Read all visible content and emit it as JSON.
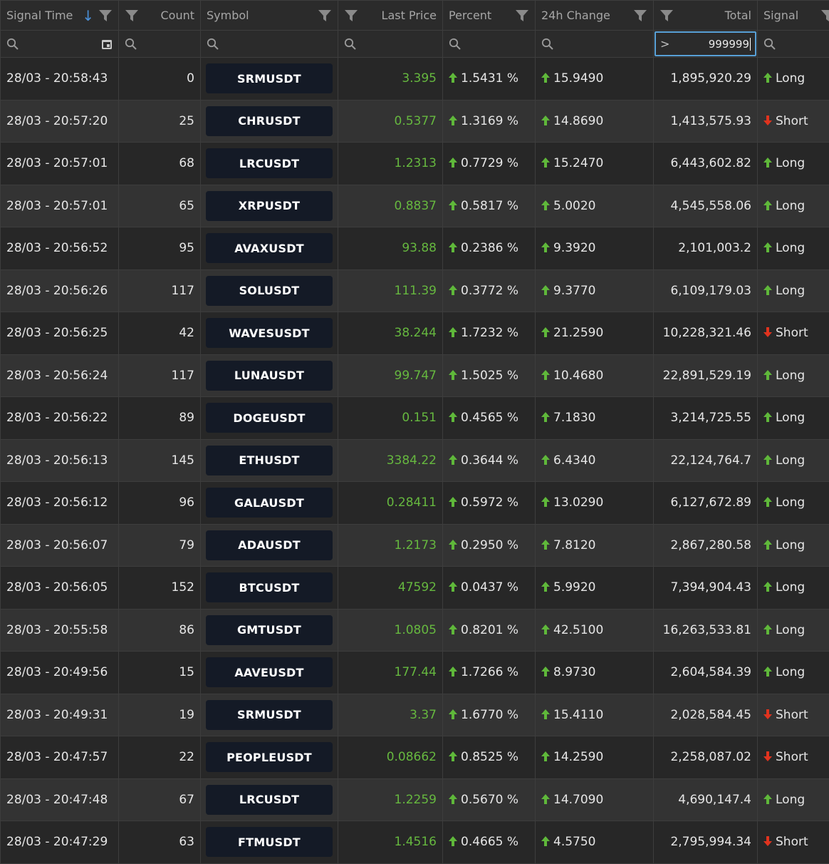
{
  "columns": {
    "signal_time": "Signal Time",
    "count": "Count",
    "symbol": "Symbol",
    "last_price": "Last Price",
    "percent": "Percent",
    "change_24h": "24h Change",
    "total": "Total",
    "signal": "Signal"
  },
  "filter": {
    "total_operator": ">",
    "total_value": "999999"
  },
  "colors": {
    "price_green": "#66b83f",
    "up_arrow": "#5fb83a",
    "down_arrow": "#e0331e",
    "focus_border": "#58a0d6",
    "symbol_bg": "#141a26"
  },
  "rows": [
    {
      "time": "28/03 - 20:58:43",
      "count": "0",
      "symbol": "SRMUSDT",
      "price": "3.395",
      "percent": "1.5431 %",
      "change": "15.9490",
      "total": "1,895,920.29",
      "signal": "Long"
    },
    {
      "time": "28/03 - 20:57:20",
      "count": "25",
      "symbol": "CHRUSDT",
      "price": "0.5377",
      "percent": "1.3169 %",
      "change": "14.8690",
      "total": "1,413,575.93",
      "signal": "Short"
    },
    {
      "time": "28/03 - 20:57:01",
      "count": "68",
      "symbol": "LRCUSDT",
      "price": "1.2313",
      "percent": "0.7729 %",
      "change": "15.2470",
      "total": "6,443,602.82",
      "signal": "Long"
    },
    {
      "time": "28/03 - 20:57:01",
      "count": "65",
      "symbol": "XRPUSDT",
      "price": "0.8837",
      "percent": "0.5817 %",
      "change": "5.0020",
      "total": "4,545,558.06",
      "signal": "Long"
    },
    {
      "time": "28/03 - 20:56:52",
      "count": "95",
      "symbol": "AVAXUSDT",
      "price": "93.88",
      "percent": "0.2386 %",
      "change": "9.3920",
      "total": "2,101,003.2",
      "signal": "Long"
    },
    {
      "time": "28/03 - 20:56:26",
      "count": "117",
      "symbol": "SOLUSDT",
      "price": "111.39",
      "percent": "0.3772 %",
      "change": "9.3770",
      "total": "6,109,179.03",
      "signal": "Long"
    },
    {
      "time": "28/03 - 20:56:25",
      "count": "42",
      "symbol": "WAVESUSDT",
      "price": "38.244",
      "percent": "1.7232 %",
      "change": "21.2590",
      "total": "10,228,321.46",
      "signal": "Short"
    },
    {
      "time": "28/03 - 20:56:24",
      "count": "117",
      "symbol": "LUNAUSDT",
      "price": "99.747",
      "percent": "1.5025 %",
      "change": "10.4680",
      "total": "22,891,529.19",
      "signal": "Long"
    },
    {
      "time": "28/03 - 20:56:22",
      "count": "89",
      "symbol": "DOGEUSDT",
      "price": "0.151",
      "percent": "0.4565 %",
      "change": "7.1830",
      "total": "3,214,725.55",
      "signal": "Long"
    },
    {
      "time": "28/03 - 20:56:13",
      "count": "145",
      "symbol": "ETHUSDT",
      "price": "3384.22",
      "percent": "0.3644 %",
      "change": "6.4340",
      "total": "22,124,764.7",
      "signal": "Long"
    },
    {
      "time": "28/03 - 20:56:12",
      "count": "96",
      "symbol": "GALAUSDT",
      "price": "0.28411",
      "percent": "0.5972 %",
      "change": "13.0290",
      "total": "6,127,672.89",
      "signal": "Long"
    },
    {
      "time": "28/03 - 20:56:07",
      "count": "79",
      "symbol": "ADAUSDT",
      "price": "1.2173",
      "percent": "0.2950 %",
      "change": "7.8120",
      "total": "2,867,280.58",
      "signal": "Long"
    },
    {
      "time": "28/03 - 20:56:05",
      "count": "152",
      "symbol": "BTCUSDT",
      "price": "47592",
      "percent": "0.0437 %",
      "change": "5.9920",
      "total": "7,394,904.43",
      "signal": "Long"
    },
    {
      "time": "28/03 - 20:55:58",
      "count": "86",
      "symbol": "GMTUSDT",
      "price": "1.0805",
      "percent": "0.8201 %",
      "change": "42.5100",
      "total": "16,263,533.81",
      "signal": "Long"
    },
    {
      "time": "28/03 - 20:49:56",
      "count": "15",
      "symbol": "AAVEUSDT",
      "price": "177.44",
      "percent": "1.7266 %",
      "change": "8.9730",
      "total": "2,604,584.39",
      "signal": "Long"
    },
    {
      "time": "28/03 - 20:49:31",
      "count": "19",
      "symbol": "SRMUSDT",
      "price": "3.37",
      "percent": "1.6770 %",
      "change": "15.4110",
      "total": "2,028,584.45",
      "signal": "Short"
    },
    {
      "time": "28/03 - 20:47:57",
      "count": "22",
      "symbol": "PEOPLEUSDT",
      "price": "0.08662",
      "percent": "0.8525 %",
      "change": "14.2590",
      "total": "2,258,087.02",
      "signal": "Short"
    },
    {
      "time": "28/03 - 20:47:48",
      "count": "67",
      "symbol": "LRCUSDT",
      "price": "1.2259",
      "percent": "0.5670 %",
      "change": "14.7090",
      "total": "4,690,147.4",
      "signal": "Long"
    },
    {
      "time": "28/03 - 20:47:29",
      "count": "63",
      "symbol": "FTMUSDT",
      "price": "1.4516",
      "percent": "0.4665 %",
      "change": "4.5750",
      "total": "2,795,994.34",
      "signal": "Short"
    }
  ]
}
